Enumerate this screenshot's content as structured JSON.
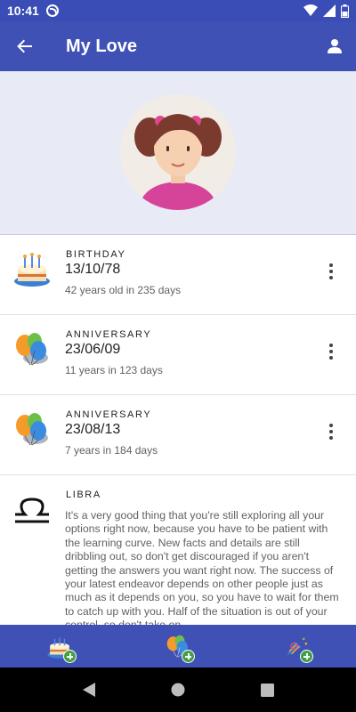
{
  "status_bar": {
    "time": "10:41"
  },
  "app_bar": {
    "title": "My Love"
  },
  "events": [
    {
      "label": "BIRTHDAY",
      "date": "13/10/78",
      "subtitle": "42 years old in 235 days",
      "icon": "birthday-cake-icon"
    },
    {
      "label": "ANNIVERSARY",
      "date": "23/06/09",
      "subtitle": "11 years in 123 days",
      "icon": "balloons-icon"
    },
    {
      "label": "ANNIVERSARY",
      "date": "23/08/13",
      "subtitle": "7 years in 184 days",
      "icon": "balloons-icon"
    }
  ],
  "zodiac": {
    "label": "LIBRA",
    "icon": "libra-icon",
    "text": "It's a very good thing that you're still exploring all your options right now, because you have to be patient with the learning curve. New facts and details are still dribbling out, so don't get discouraged if you aren't getting the answers you want right now. The success of your latest endeavor depends on other people just as much as it depends on you, so you have to wait for them to catch up with you. Half of the situation is out of your control, so don't take on"
  },
  "bottom_bar": {
    "buttons": [
      "add-birthday-button",
      "add-anniversary-button",
      "add-party-button"
    ]
  },
  "colors": {
    "primary": "#3f51b5",
    "status_bar": "#3a4cb5",
    "header_bg": "#e8eaf6",
    "badge_green": "#43a047"
  }
}
